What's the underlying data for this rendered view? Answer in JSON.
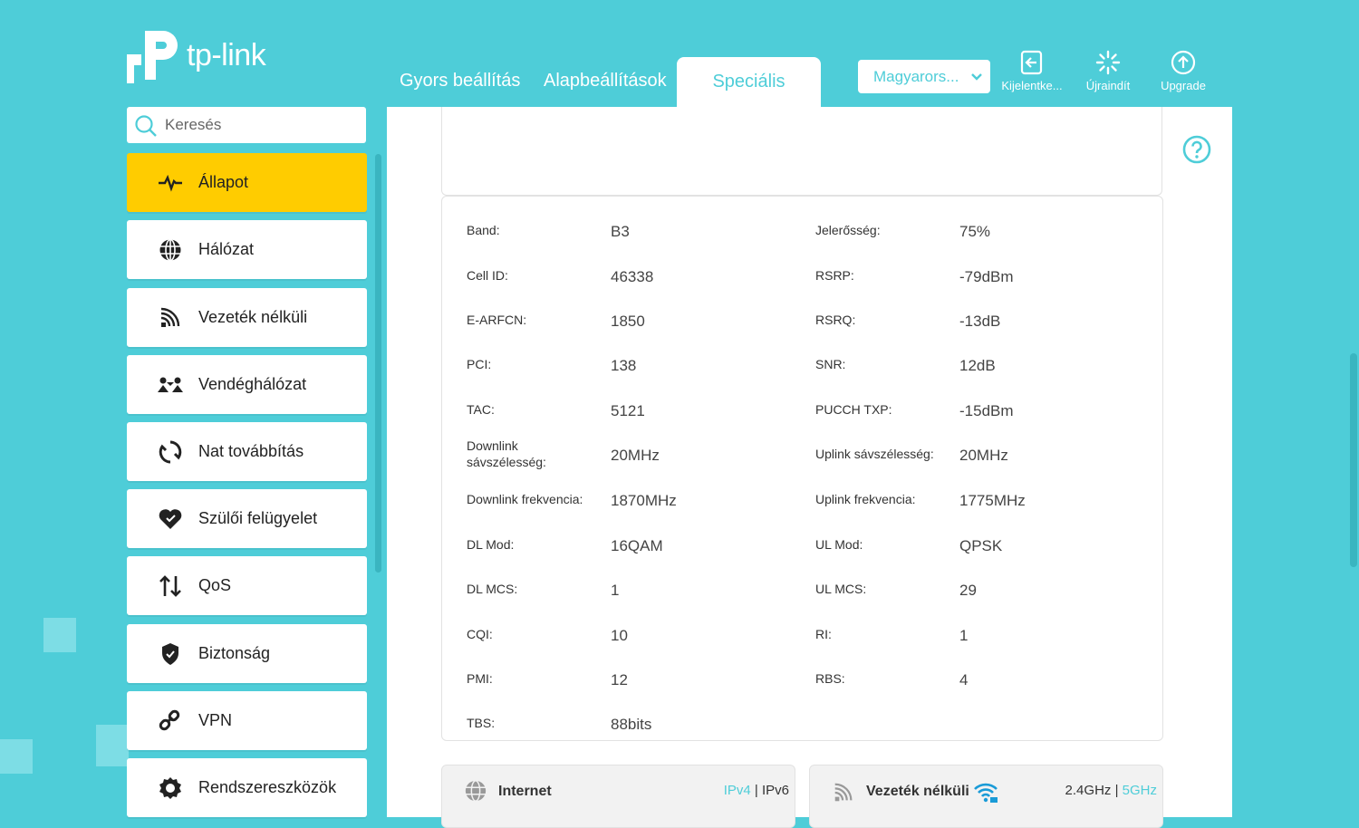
{
  "brand": {
    "logo_text": "tp-link"
  },
  "nav": {
    "tabs": [
      "Gyors beállítás",
      "Alapbeállítások",
      "Speciális"
    ],
    "active_tab": "Speciális"
  },
  "language": {
    "selected": "Magyarors..."
  },
  "top_actions": {
    "logout": "Kijelentke...",
    "reboot": "Újraindít",
    "upgrade": "Upgrade"
  },
  "search": {
    "placeholder": "Keresés"
  },
  "sidebar": {
    "items": [
      {
        "label": "Állapot",
        "icon": "pulse-icon",
        "active": true
      },
      {
        "label": "Hálózat",
        "icon": "globe-icon"
      },
      {
        "label": "Vezeték nélküli",
        "icon": "wireless-icon"
      },
      {
        "label": "Vendéghálózat",
        "icon": "guests-icon"
      },
      {
        "label": "Nat továbbítás",
        "icon": "nat-icon"
      },
      {
        "label": "Szülői felügyelet",
        "icon": "heart-icon"
      },
      {
        "label": "QoS",
        "icon": "updown-arrows-icon"
      },
      {
        "label": "Biztonság",
        "icon": "shield-icon"
      },
      {
        "label": "VPN",
        "icon": "link-icon"
      },
      {
        "label": "Rendszereszközök",
        "icon": "gear-icon"
      }
    ]
  },
  "cell_info": {
    "rows": [
      {
        "l1": "Band:",
        "v1": "B3",
        "l2": "Jelerősség:",
        "v2": "75%"
      },
      {
        "l1": "Cell ID:",
        "v1": "46338",
        "l2": "RSRP:",
        "v2": "-79dBm"
      },
      {
        "l1": "E-ARFCN:",
        "v1": "1850",
        "l2": "RSRQ:",
        "v2": "-13dB"
      },
      {
        "l1": "PCI:",
        "v1": "138",
        "l2": "SNR:",
        "v2": "12dB"
      },
      {
        "l1": "TAC:",
        "v1": "5121",
        "l2": "PUCCH TXP:",
        "v2": "-15dBm"
      },
      {
        "l1": "Downlink sávszélesség:",
        "v1": "20MHz",
        "l2": "Uplink sávszélesség:",
        "v2": "20MHz"
      },
      {
        "l1": "Downlink frekvencia:",
        "v1": "1870MHz",
        "l2": "Uplink frekvencia:",
        "v2": "1775MHz"
      },
      {
        "l1": "DL Mod:",
        "v1": "16QAM",
        "l2": "UL Mod:",
        "v2": "QPSK"
      },
      {
        "l1": "DL MCS:",
        "v1": "1",
        "l2": "UL MCS:",
        "v2": "29"
      },
      {
        "l1": "CQI:",
        "v1": "10",
        "l2": "RI:",
        "v2": "1"
      },
      {
        "l1": "PMI:",
        "v1": "12",
        "l2": "RBS:",
        "v2": "4"
      },
      {
        "l1": "TBS:",
        "v1": "88bits",
        "l2": "",
        "v2": ""
      }
    ]
  },
  "bottom_cards": {
    "internet": {
      "title": "Internet",
      "link1": "IPv4",
      "sep": "|",
      "link2": "IPv6"
    },
    "wireless": {
      "title": "Vezeték nélküli",
      "link1": "2.4GHz",
      "sep": "|",
      "link2": "5GHz"
    }
  },
  "colors": {
    "accent": "#4ecdd8",
    "active": "#ffcc00"
  }
}
